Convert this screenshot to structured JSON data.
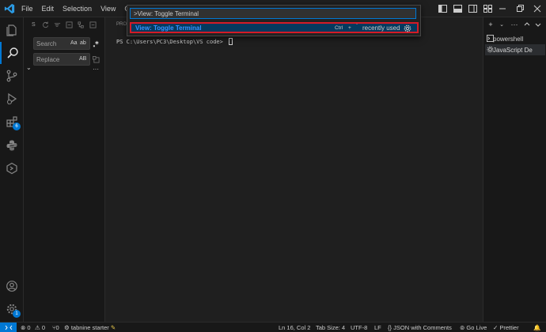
{
  "menu": [
    "File",
    "Edit",
    "Selection",
    "View",
    "Go"
  ],
  "palette": {
    "input_value": ">View: Toggle Terminal",
    "item_label": "View: Toggle Terminal",
    "keybinding_ctrl": "Ctrl",
    "keybinding_plus": "+",
    "keybinding_key": "`",
    "recently_used": "recently used"
  },
  "sidebar": {
    "header": "S",
    "search_placeholder": "Search",
    "match_case": "Aa",
    "match_word": "ab",
    "replace_placeholder": "Replace",
    "preserve_case": "AB",
    "more": "···"
  },
  "editor": {
    "panel_tab_fragment": "PRO",
    "terminal_prompt": "PS C:\\Users\\PC3\\Desktop\\VS code> "
  },
  "terminal_list": {
    "items": [
      "powershell",
      "JavaScript De"
    ]
  },
  "activity": {
    "extensions_badge": "6",
    "accounts_badge": "1"
  },
  "status": {
    "errors": "0",
    "warnings": "0",
    "ports": "0",
    "tabnine": "tabnine starter",
    "position": "Ln 16, Col 2",
    "tab_size": "Tab Size: 4",
    "encoding": "UTF-8",
    "eol": "LF",
    "language": "JSON with Comments",
    "go_live": "Go Live",
    "prettier": "Prettier"
  },
  "colors": {
    "accent": "#0078d4",
    "highlight_border": "#d31b27",
    "selected_item_bg": "#04395e",
    "selected_item_text": "#3794ff"
  }
}
